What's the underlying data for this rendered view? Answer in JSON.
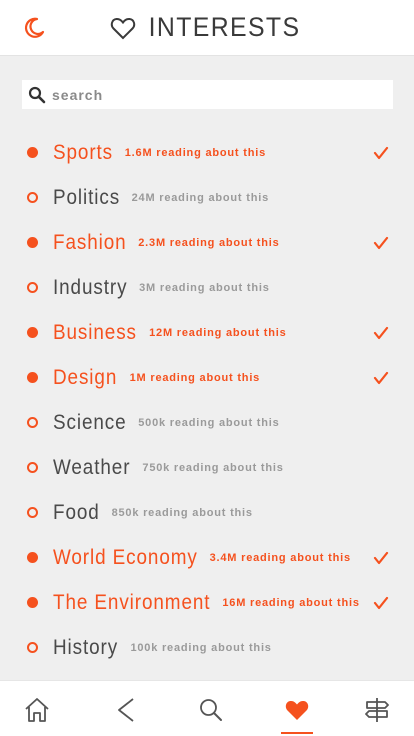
{
  "header": {
    "title": "INTERESTS",
    "title_icon": "heart-outline-icon",
    "left_icon": "moon-icon"
  },
  "search": {
    "placeholder": "search",
    "value": "",
    "icon": "search-icon"
  },
  "colors": {
    "accent": "#f5511e",
    "text": "#4a4a4a",
    "muted": "#9a9a9a"
  },
  "interests": [
    {
      "name": "Sports",
      "count": "1.6M reading about this",
      "selected": true
    },
    {
      "name": "Politics",
      "count": "24M reading about this",
      "selected": false
    },
    {
      "name": "Fashion",
      "count": "2.3M reading about this",
      "selected": true
    },
    {
      "name": "Industry",
      "count": "3M reading about this",
      "selected": false
    },
    {
      "name": "Business",
      "count": "12M reading about this",
      "selected": true
    },
    {
      "name": "Design",
      "count": "1M reading about this",
      "selected": true
    },
    {
      "name": "Science",
      "count": "500k reading about this",
      "selected": false
    },
    {
      "name": "Weather",
      "count": "750k reading about this",
      "selected": false
    },
    {
      "name": "Food",
      "count": "850k reading about this",
      "selected": false
    },
    {
      "name": "World Economy",
      "count": "3.4M reading about this",
      "selected": true
    },
    {
      "name": "The Environment",
      "count": "16M reading about this",
      "selected": true
    },
    {
      "name": "History",
      "count": "100k reading about this",
      "selected": false
    }
  ],
  "tabbar": {
    "tabs": [
      {
        "icon": "home-icon",
        "active": false
      },
      {
        "icon": "lightning-icon",
        "active": false
      },
      {
        "icon": "search-icon",
        "active": false
      },
      {
        "icon": "heart-icon",
        "active": true
      },
      {
        "icon": "signpost-icon",
        "active": false
      }
    ]
  }
}
